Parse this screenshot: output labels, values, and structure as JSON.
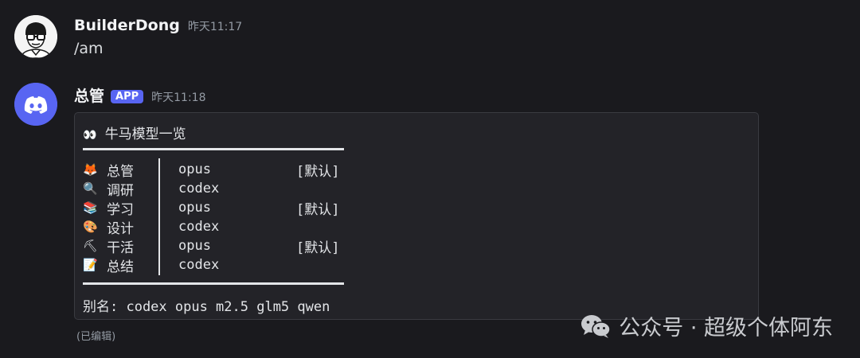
{
  "messages": [
    {
      "username": "BuilderDong",
      "timestamp": "昨天11:17",
      "content": "/am",
      "avatar_icon": "user-avatar-glasses"
    },
    {
      "username": "总管",
      "badge": "APP",
      "timestamp": "昨天11:18",
      "avatar_icon": "discord-logo-icon",
      "codeblock": {
        "title_icon": "👀",
        "title": "牛马模型一览",
        "rows": [
          {
            "icon": "🦊",
            "name": "总管",
            "model": "opus",
            "tag": "[默认]"
          },
          {
            "icon": "🔍",
            "name": "调研",
            "model": "codex",
            "tag": ""
          },
          {
            "icon": "📚",
            "name": "学习",
            "model": "opus",
            "tag": "[默认]"
          },
          {
            "icon": "🎨",
            "name": "设计",
            "model": "codex",
            "tag": ""
          },
          {
            "icon": "⛏",
            "name": "干活",
            "model": "opus",
            "tag": "[默认]"
          },
          {
            "icon": "📝",
            "name": "总结",
            "model": "codex",
            "tag": ""
          }
        ],
        "alias": "别名: codex opus m2.5 glm5 qwen"
      },
      "edited": "(已编辑)"
    }
  ],
  "watermark": {
    "text": "公众号 · 超级个体阿东",
    "icon": "wechat-icon"
  },
  "colors": {
    "background": "#1a1a1e",
    "badge": "#5865f2",
    "discord_blurple": "#5865f2"
  }
}
